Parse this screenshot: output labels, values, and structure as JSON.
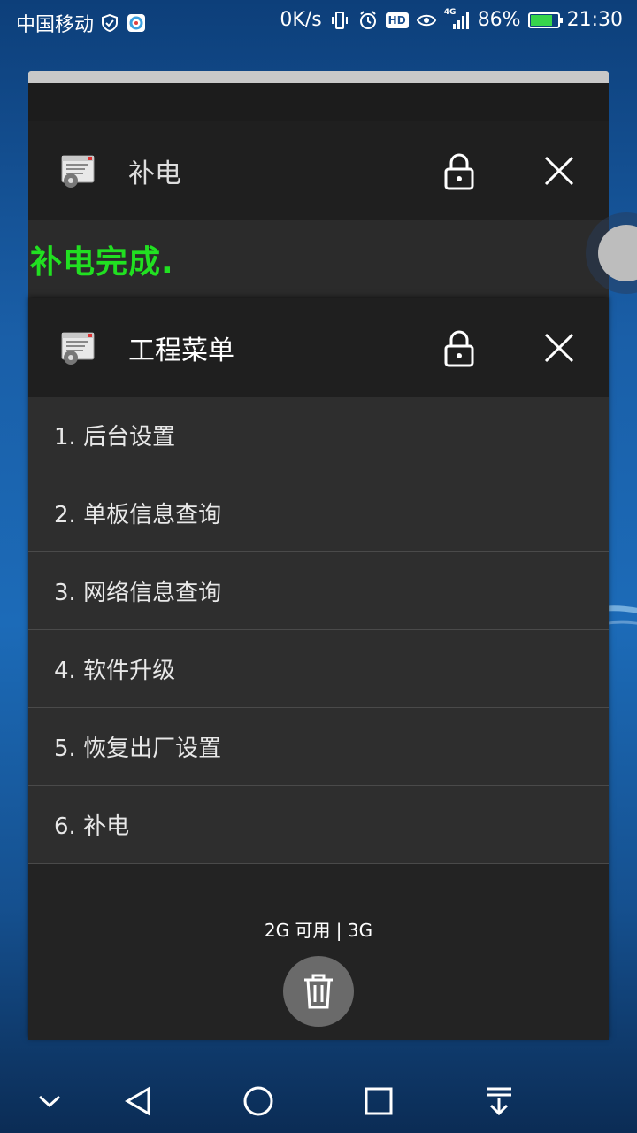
{
  "status_bar": {
    "carrier": "中国移动",
    "net_speed": "0K/s",
    "network_type": "4G",
    "battery_percent": "86%",
    "battery_level": 0.86,
    "time": "21:30",
    "hd_label": "HD"
  },
  "recent_cards": [
    {
      "title": "补电",
      "content_text": "补电完成."
    },
    {
      "title": "工程菜单",
      "menu_items": [
        "1. 后台设置",
        "2. 单板信息查询",
        "3. 网络信息查询",
        "4. 软件升级",
        "5. 恢复出厂设置",
        "6. 补电"
      ]
    }
  ],
  "memory_info": "2G 可用 | 3G",
  "colors": {
    "success_text": "#21e021",
    "battery_fill": "#37d44b"
  },
  "icons": {
    "lock": "lock-icon",
    "close": "close-icon",
    "trash": "trash-icon",
    "nav_down": "chevron-down-icon",
    "nav_back": "back-icon",
    "nav_home": "home-icon",
    "nav_recents": "recents-icon",
    "nav_notifications": "pull-down-notification-icon"
  }
}
